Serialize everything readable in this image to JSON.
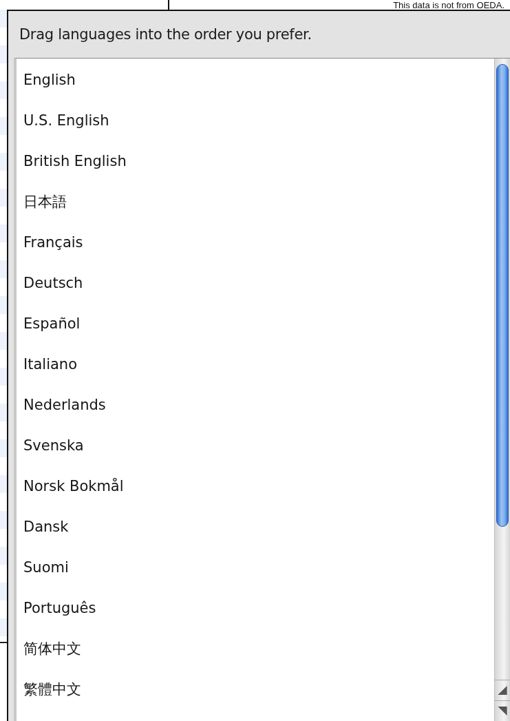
{
  "background_note": "This data is not from OEDA.",
  "instruction": "Drag languages into the order you prefer.",
  "languages": [
    {
      "label": "English"
    },
    {
      "label": "U.S. English"
    },
    {
      "label": "British English"
    },
    {
      "label": "日本語"
    },
    {
      "label": "Français"
    },
    {
      "label": "Deutsch"
    },
    {
      "label": "Español"
    },
    {
      "label": "Italiano"
    },
    {
      "label": "Nederlands"
    },
    {
      "label": "Svenska"
    },
    {
      "label": "Norsk Bokmål"
    },
    {
      "label": "Dansk"
    },
    {
      "label": "Suomi"
    },
    {
      "label": "Português"
    },
    {
      "label": "简体中文"
    },
    {
      "label": "繁體中文"
    }
  ]
}
